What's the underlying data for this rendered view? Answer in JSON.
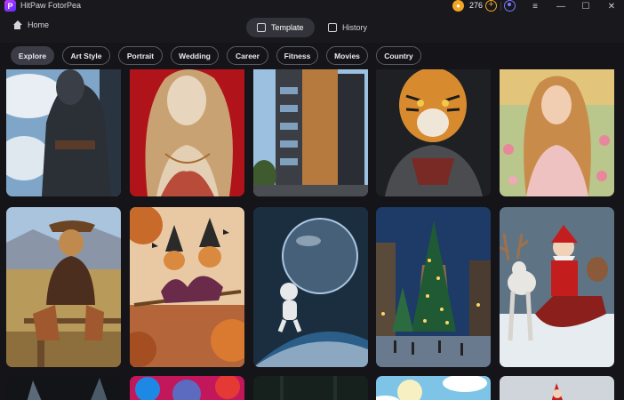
{
  "app": {
    "title": "HitPaw FotorPea",
    "logo_letter": "P",
    "credits": "276"
  },
  "nav": {
    "home_label": "Home",
    "tabs": [
      {
        "label": "Template",
        "active": true
      },
      {
        "label": "History",
        "active": false
      }
    ]
  },
  "categories": [
    "Explore",
    "Art Style",
    "Portrait",
    "Wedding",
    "Career",
    "Fitness",
    "Movies",
    "Country"
  ],
  "active_category": "Explore",
  "colors": {
    "accent": "#7a78ff",
    "credit": "#f2a623",
    "bg": "#141419",
    "panel": "#18181d"
  },
  "templates": [
    {
      "subject": "Armored knight against cloudy sky"
    },
    {
      "subject": "Classical female statue on red background"
    },
    {
      "subject": "Modern apartment building facade"
    },
    {
      "subject": "Tiger-headed warrior in armor"
    },
    {
      "subject": "Woman in floral dress in flower field"
    },
    {
      "subject": "Cowboy cat sitting on fence"
    },
    {
      "subject": "Witch cats flying on broom in autumn"
    },
    {
      "subject": "Astronaut with glass sphere above earth"
    },
    {
      "subject": "Christmas tree in snowy town square"
    },
    {
      "subject": "Santa Claus in sleigh with reindeer"
    },
    {
      "subject": "Dark fantasy creature"
    },
    {
      "subject": "Colorful psychedelic face"
    },
    {
      "subject": "Dark forest scene"
    },
    {
      "subject": "Cartoon sky with clouds"
    },
    {
      "subject": "Snowy Santa scene"
    }
  ]
}
